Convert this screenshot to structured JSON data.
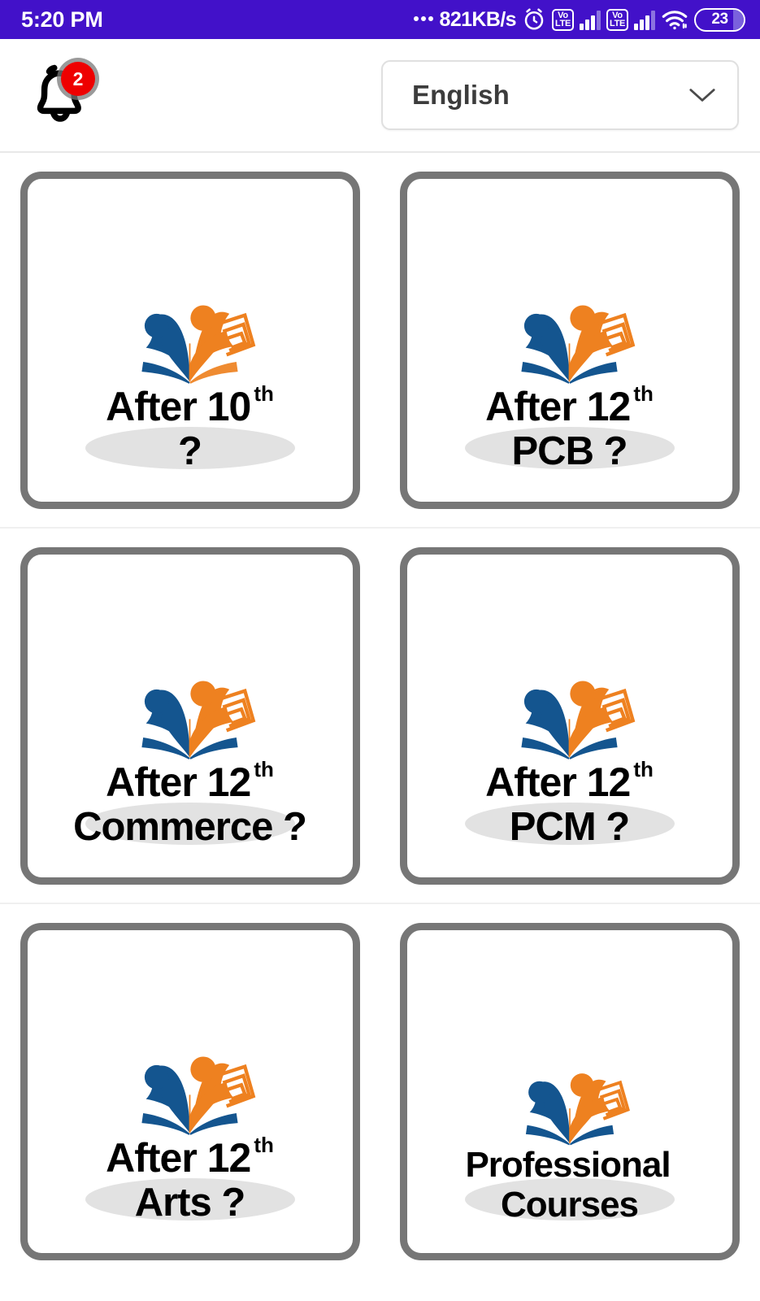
{
  "status_bar": {
    "clock": "5:20 PM",
    "network_speed": "821KB/s",
    "alarm_icon": "alarm-clock-icon",
    "sim1_volte": {
      "top": "Vo",
      "bottom": "LTE"
    },
    "sim2_volte": {
      "top": "Vo",
      "bottom": "LTE"
    },
    "wifi_icon": "wifi-icon",
    "battery_level": "23",
    "background_color": "#4211c9"
  },
  "header": {
    "notification_icon": "bell-icon",
    "notification_count": "2",
    "notification_badge_color": "#ee0000",
    "language_selector": {
      "value": "English",
      "chevron_icon": "chevron-down-icon"
    }
  },
  "grid": {
    "border_color": "#767676",
    "logo_blue": "#14558f",
    "logo_orange": "#ee8120",
    "cards": [
      {
        "name": "after-10th",
        "line1": "After 10",
        "sup": "th",
        "line2": "?"
      },
      {
        "name": "after-12th-pcb",
        "line1": "After 12",
        "sup": "th",
        "line2": "PCB ?"
      },
      {
        "name": "after-12th-commerce",
        "line1": "After 12",
        "sup": "th",
        "line2": "Commerce ?"
      },
      {
        "name": "after-12th-pcm",
        "line1": "After 12",
        "sup": "th",
        "line2": "PCM ?"
      },
      {
        "name": "after-12th-arts",
        "line1": "After 12",
        "sup": "th",
        "line2": "Arts ?"
      },
      {
        "name": "professional-courses",
        "line1": "Professional",
        "sup": "",
        "line2": "Courses"
      }
    ]
  }
}
